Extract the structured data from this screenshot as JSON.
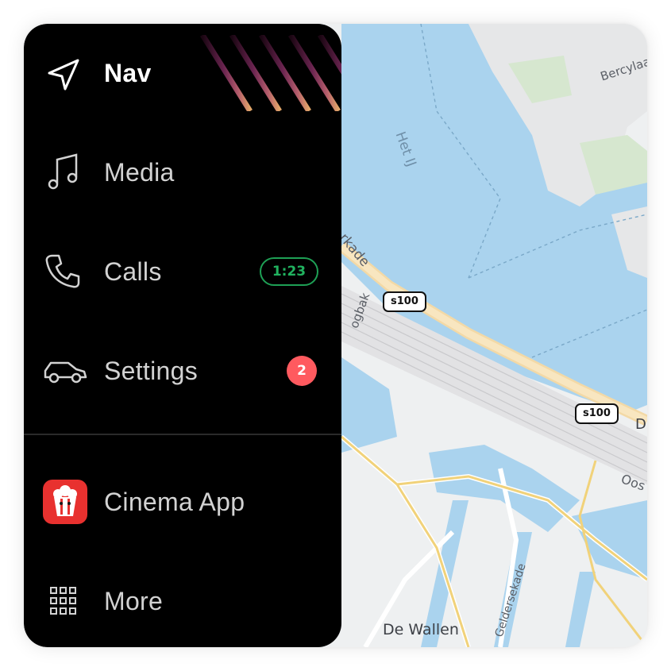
{
  "sidebar": {
    "items": [
      {
        "label": "Nav",
        "icon": "navigation-arrow-icon",
        "active": true
      },
      {
        "label": "Media",
        "icon": "music-note-icon"
      },
      {
        "label": "Calls",
        "icon": "phone-icon",
        "status": "1:23"
      },
      {
        "label": "Settings",
        "icon": "car-icon",
        "badge": "2"
      },
      {
        "label": "Cinema App",
        "icon": "popcorn-icon"
      },
      {
        "label": "More",
        "icon": "grid-icon"
      }
    ]
  },
  "map": {
    "labels": {
      "het_ij": "Het IJ",
      "berclay": "Bercylaa",
      "kade": "rkade",
      "ogbak": "ogbak",
      "de_wallen": "De Wallen",
      "geldersekade": "Geldersekade",
      "oost": "Oos",
      "d": "D"
    },
    "shields": [
      "s100",
      "s100"
    ]
  },
  "colors": {
    "sidebar_bg": "#000000",
    "water": "#aad3ee",
    "land": "#eef0f1",
    "green_timer": "#21b25f",
    "badge": "#ff5a5f",
    "cinema_icon": "#e8312f"
  }
}
